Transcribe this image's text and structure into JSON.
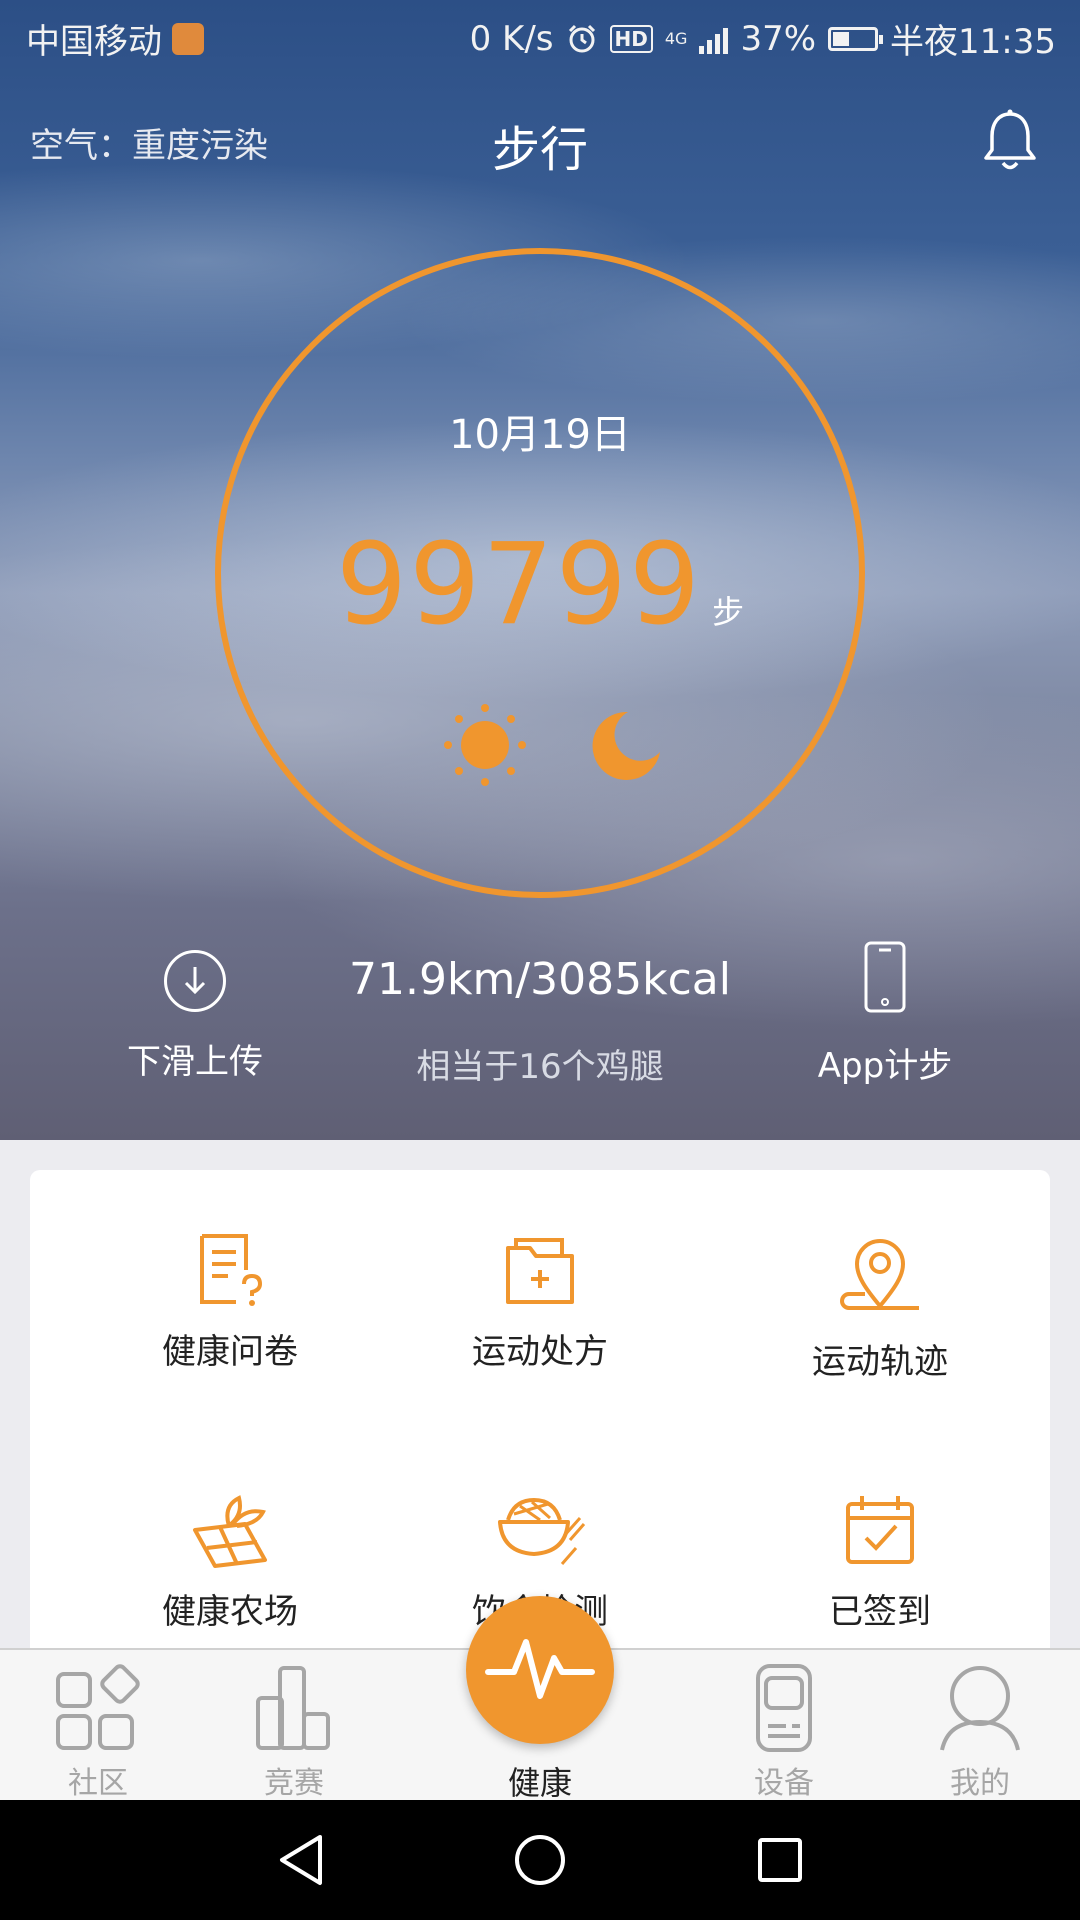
{
  "status": {
    "carrier": "中国移动",
    "speed": "0 K/s",
    "hd": "HD",
    "network": "4G",
    "battery": "37%",
    "time": "半夜11:35"
  },
  "header": {
    "air_quality": "空气：重度污染",
    "title": "步行",
    "notification_icon": "bell-icon"
  },
  "steps": {
    "date": "10月19日",
    "count": "99799",
    "unit": "步",
    "progress": 1.0,
    "accent": "#f0962e"
  },
  "stats": {
    "upload_label": "下滑上传",
    "distance_calories": "71.9km/3085kcal",
    "equivalent": "相当于16个鸡腿",
    "app_steps_label": "App计步"
  },
  "features": [
    {
      "label": "健康问卷",
      "icon": "questionnaire-icon"
    },
    {
      "label": "运动处方",
      "icon": "prescription-folder-icon"
    },
    {
      "label": "运动轨迹",
      "icon": "location-track-icon"
    },
    {
      "label": "健康农场",
      "icon": "farm-sprout-icon"
    },
    {
      "label": "饮食检测",
      "icon": "food-bowl-icon"
    },
    {
      "label": "已签到",
      "icon": "calendar-check-icon"
    }
  ],
  "tabs": [
    {
      "label": "社区",
      "icon": "community-icon"
    },
    {
      "label": "竞赛",
      "icon": "competition-icon"
    },
    {
      "label": "健康",
      "icon": "heartbeat-icon"
    },
    {
      "label": "设备",
      "icon": "device-icon"
    },
    {
      "label": "我的",
      "icon": "profile-icon"
    }
  ],
  "nav": [
    "back-icon",
    "home-icon",
    "recents-icon"
  ]
}
